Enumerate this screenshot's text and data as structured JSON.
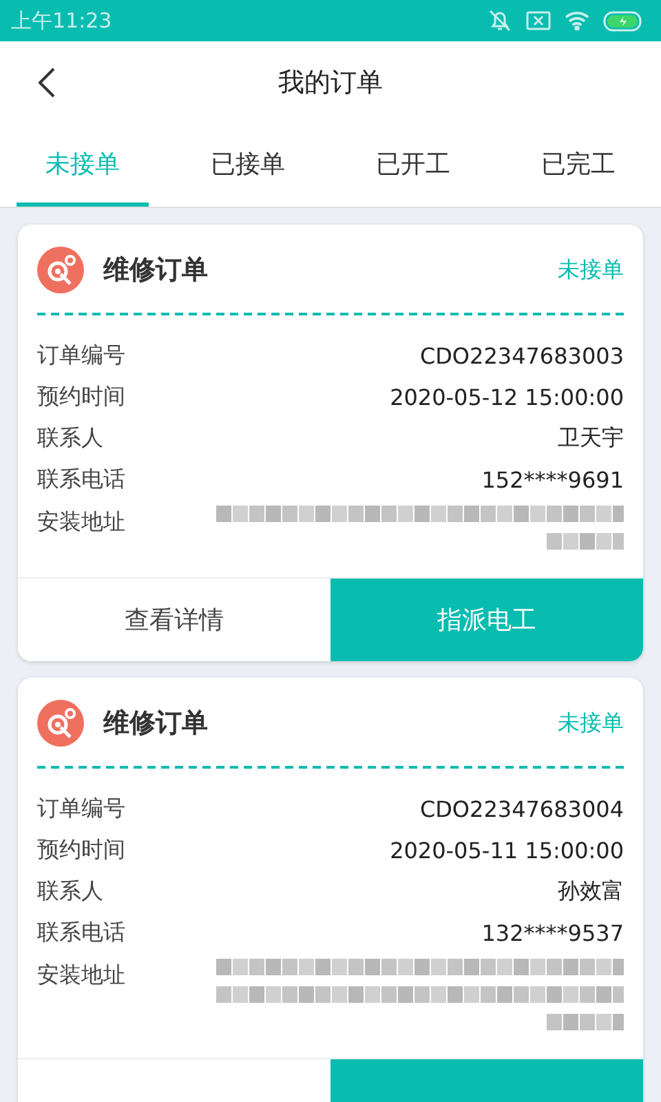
{
  "status_bar": {
    "time": "上午11:23"
  },
  "header": {
    "title": "我的订单"
  },
  "tabs": [
    {
      "label": "未接单",
      "selected": true
    },
    {
      "label": "已接单",
      "selected": false
    },
    {
      "label": "已开工",
      "selected": false
    },
    {
      "label": "已完工",
      "selected": false
    }
  ],
  "orders": [
    {
      "title": "维修订单",
      "status": "未接单",
      "fields": [
        {
          "label": "订单编号",
          "value": "CDO22347683003"
        },
        {
          "label": "预约时间",
          "value": "2020-05-12 15:00:00"
        },
        {
          "label": "联系人",
          "value": "卫天宇"
        },
        {
          "label": "联系电话",
          "value": "152****9691"
        }
      ],
      "address_label": "安装地址",
      "address_blur": [
        {
          "kind": "full"
        },
        {
          "kind": "short"
        }
      ],
      "buttons": [
        {
          "label": "查看详情",
          "kind": "secondary"
        },
        {
          "label": "指派电工",
          "kind": "primary"
        }
      ]
    },
    {
      "title": "维修订单",
      "status": "未接单",
      "fields": [
        {
          "label": "订单编号",
          "value": "CDO22347683004"
        },
        {
          "label": "预约时间",
          "value": "2020-05-11 15:00:00"
        },
        {
          "label": "联系人",
          "value": "孙效富"
        },
        {
          "label": "联系电话",
          "value": "132****9537"
        }
      ],
      "address_label": "安装地址",
      "address_blur": [
        {
          "kind": "full"
        },
        {
          "kind": "full"
        },
        {
          "kind": "short"
        }
      ]
    }
  ]
}
